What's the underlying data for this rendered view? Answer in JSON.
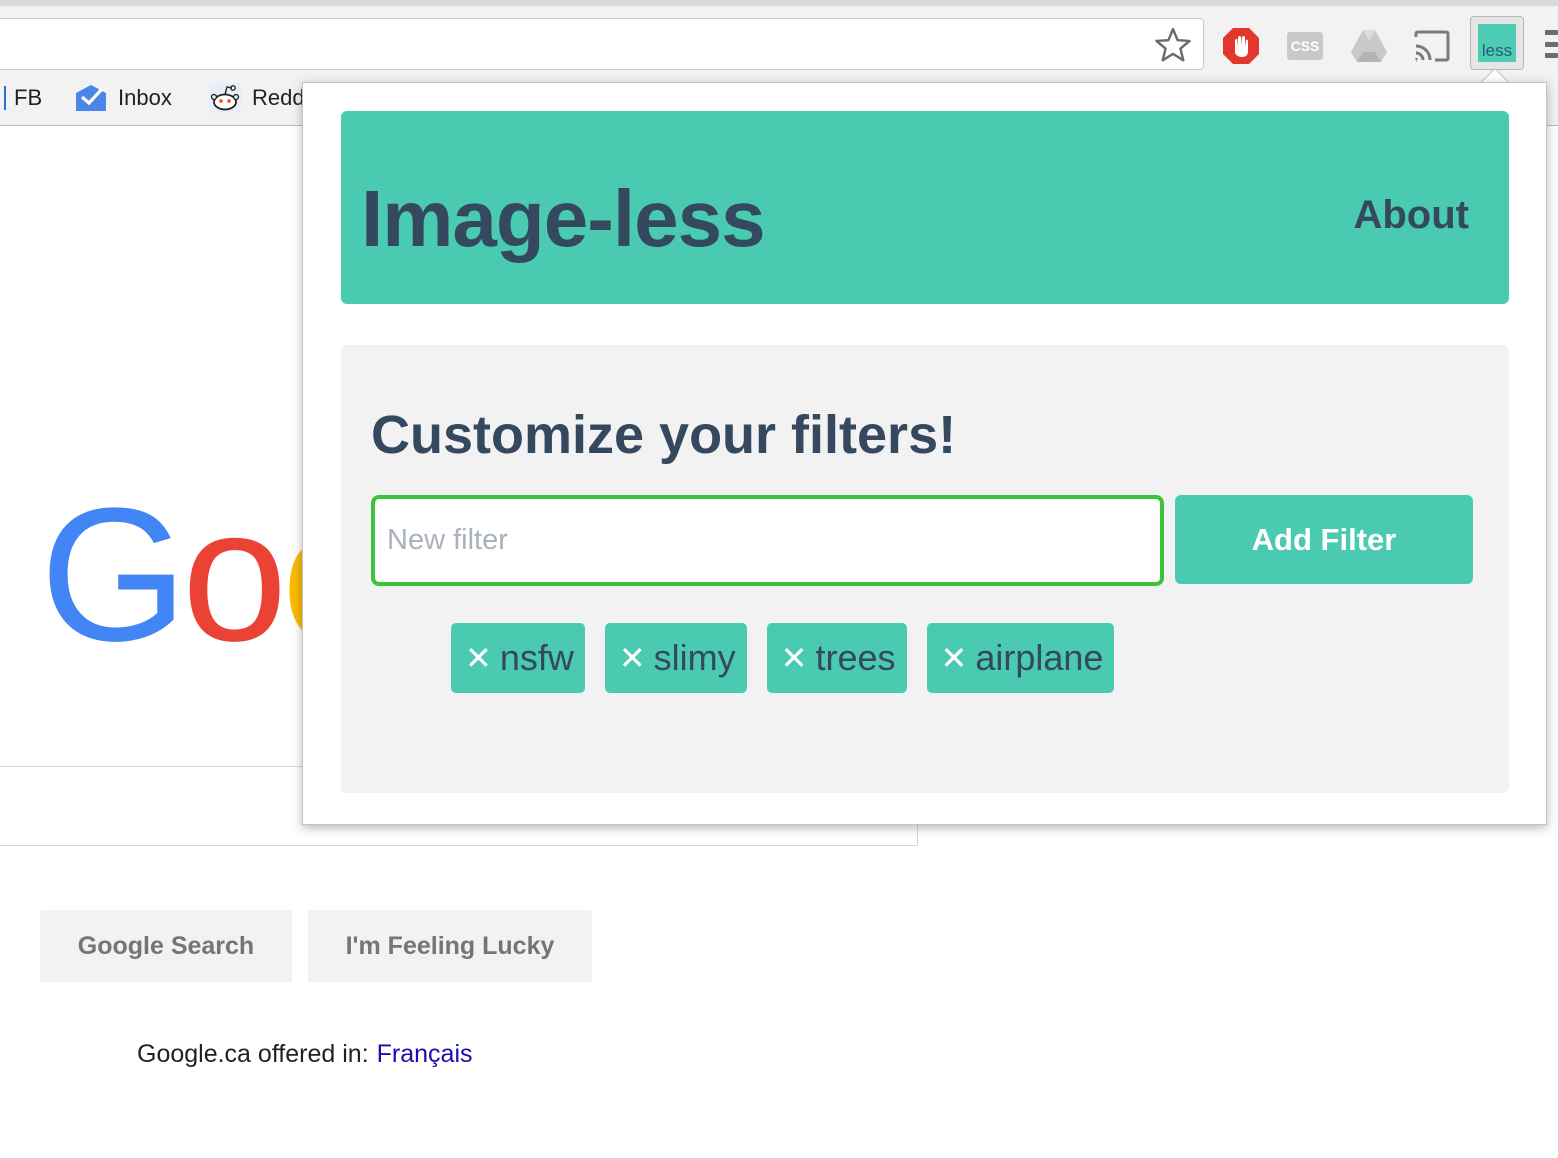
{
  "browser": {
    "bookmarks": [
      {
        "label": "FB"
      },
      {
        "label": "Inbox"
      },
      {
        "label": "Redd"
      }
    ],
    "extensions": {
      "less_label": "less",
      "css_label": "CSS"
    }
  },
  "google": {
    "logo_letters": [
      "G",
      "o",
      "o"
    ],
    "search_button": "Google Search",
    "lucky_button": "I'm Feeling Lucky",
    "offered_in": "Google.ca offered in:",
    "language_link": "Français"
  },
  "popup": {
    "app_title": "Image-less",
    "about_link": "About",
    "panel_title": "Customize your filters!",
    "input_placeholder": "New filter",
    "add_button": "Add Filter",
    "remove_glyph": "✕",
    "filters": [
      "nsfw",
      "slimy",
      "trees",
      "airplane"
    ]
  },
  "colors": {
    "accent": "#4acab0",
    "text_dark": "#34495e",
    "input_border": "#3bc43a",
    "panel_bg": "#f2f2f2"
  }
}
